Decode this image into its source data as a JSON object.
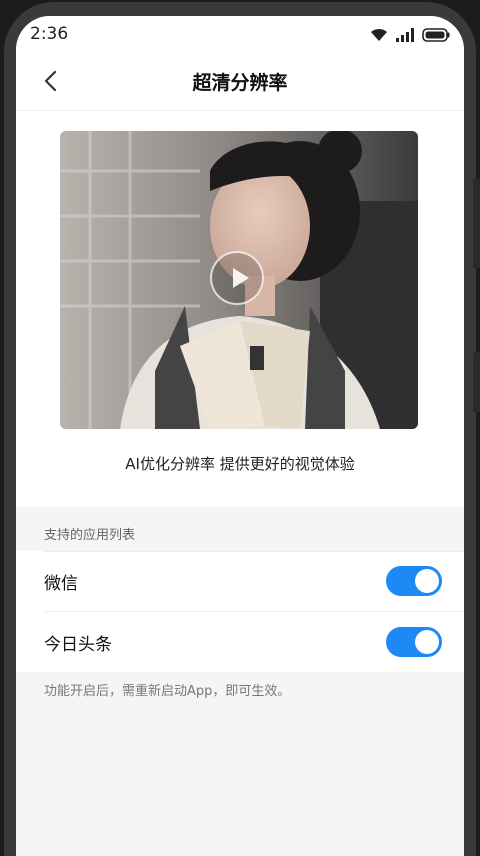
{
  "status_bar": {
    "time": "2:36"
  },
  "header": {
    "title": "超清分辨率"
  },
  "hero": {
    "caption": "AI优化分辨率 提供更好的视觉体验"
  },
  "apps_section": {
    "label": "支持的应用列表",
    "items": [
      {
        "label": "微信",
        "enabled": true
      },
      {
        "label": "今日头条",
        "enabled": true
      }
    ]
  },
  "footer_note": "功能开启后，需重新启动App，即可生效。",
  "colors": {
    "accent": "#1e88f5",
    "background": "#f5f5f5"
  }
}
